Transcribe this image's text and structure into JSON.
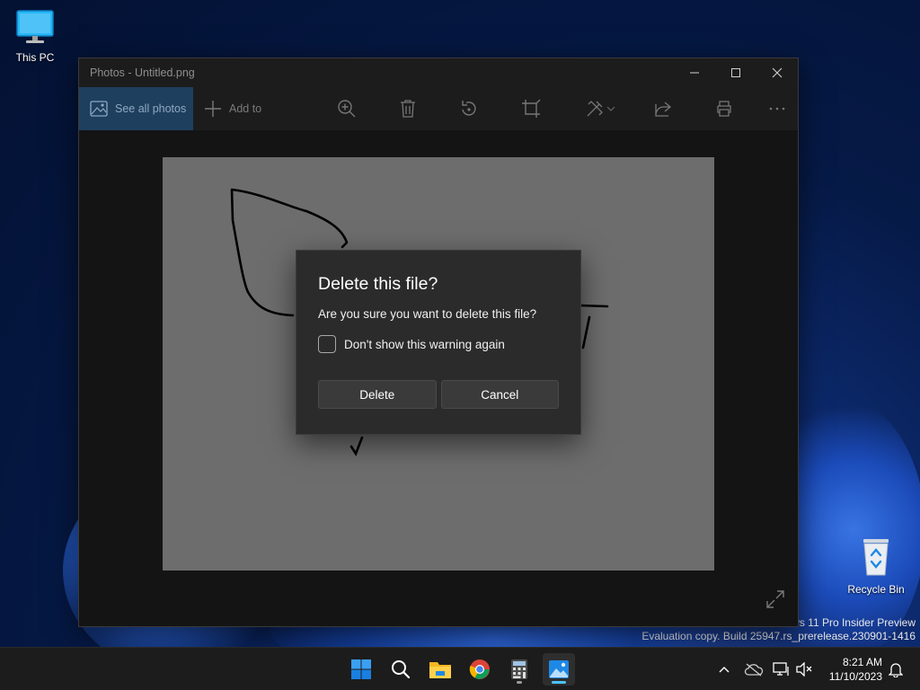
{
  "desktop": {
    "icons": [
      {
        "label": "This PC"
      },
      {
        "label": "Recycle Bin"
      }
    ],
    "watermark": {
      "line1": "ws 11 Pro Insider Preview",
      "line2": "Evaluation copy. Build 25947.rs_prerelease.230901-1416"
    }
  },
  "window": {
    "title": "Photos - Untitled.png",
    "toolbar": {
      "see_all_photos": "See all photos",
      "add_to": "Add to",
      "tools": [
        "zoom-in-icon",
        "delete-icon",
        "rotate-icon",
        "crop-icon",
        "edit-icon",
        "share-icon",
        "print-icon",
        "more-icon"
      ]
    }
  },
  "dialog": {
    "title": "Delete this file?",
    "message": "Are you sure you want to delete this file?",
    "checkbox_label": "Don't show this warning again",
    "checkbox_checked": false,
    "delete_label": "Delete",
    "cancel_label": "Cancel"
  },
  "taskbar": {
    "apps": [
      "start-icon",
      "search-icon",
      "file-explorer-icon",
      "chrome-icon",
      "calculator-icon",
      "photos-icon"
    ],
    "active_app": "photos-icon",
    "clock": {
      "time": "8:21 AM",
      "date": "11/10/2023"
    }
  },
  "colors": {
    "accent": "#0078d4",
    "dialog_bg": "#2b2b2b",
    "window_bg": "#1c1c1c"
  }
}
